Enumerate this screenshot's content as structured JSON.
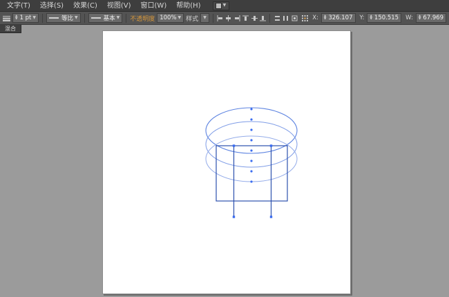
{
  "colors": {
    "menu_bg": "#3e3e3e",
    "control_bg": "#535353",
    "canvas_bg": "#9b9b9b",
    "artboard_bg": "#ffffff",
    "accent_orange": "#d6973b",
    "path_light_blue": "#7d9be6",
    "path_mid_blue": "#5b82e0",
    "path_dark_blue": "#2b4fad",
    "anchor_blue": "#3a6cf0"
  },
  "menu": {
    "items": [
      "文字(T)",
      "选择(S)",
      "效果(C)",
      "视图(V)",
      "窗口(W)",
      "帮助(H)"
    ],
    "arrange_icon": "arrange-documents-grid"
  },
  "control_bar": {
    "stroke_weight_value": "1 pt",
    "profile_label": "等比",
    "brush_label": "基本",
    "opacity_label": "不透明度",
    "opacity_value": "100%",
    "style_label": "样式",
    "icons": [
      "align-horizontal-left",
      "align-horizontal-center",
      "align-horizontal-right",
      "align-vertical-top",
      "align-vertical-middle",
      "align-vertical-bottom",
      "distribute-vertical",
      "distribute-horizontal",
      "transform-panel"
    ],
    "transform_fields": [
      {
        "label": "X:",
        "value": "326.107"
      },
      {
        "label": "Y:",
        "value": "150.515"
      },
      {
        "label": "W:",
        "value": "67.969"
      }
    ]
  },
  "document_tab": {
    "label": "混合"
  },
  "artwork": {
    "description": "blend of three ellipses above a rectangle with two legs and spine anchor points"
  }
}
